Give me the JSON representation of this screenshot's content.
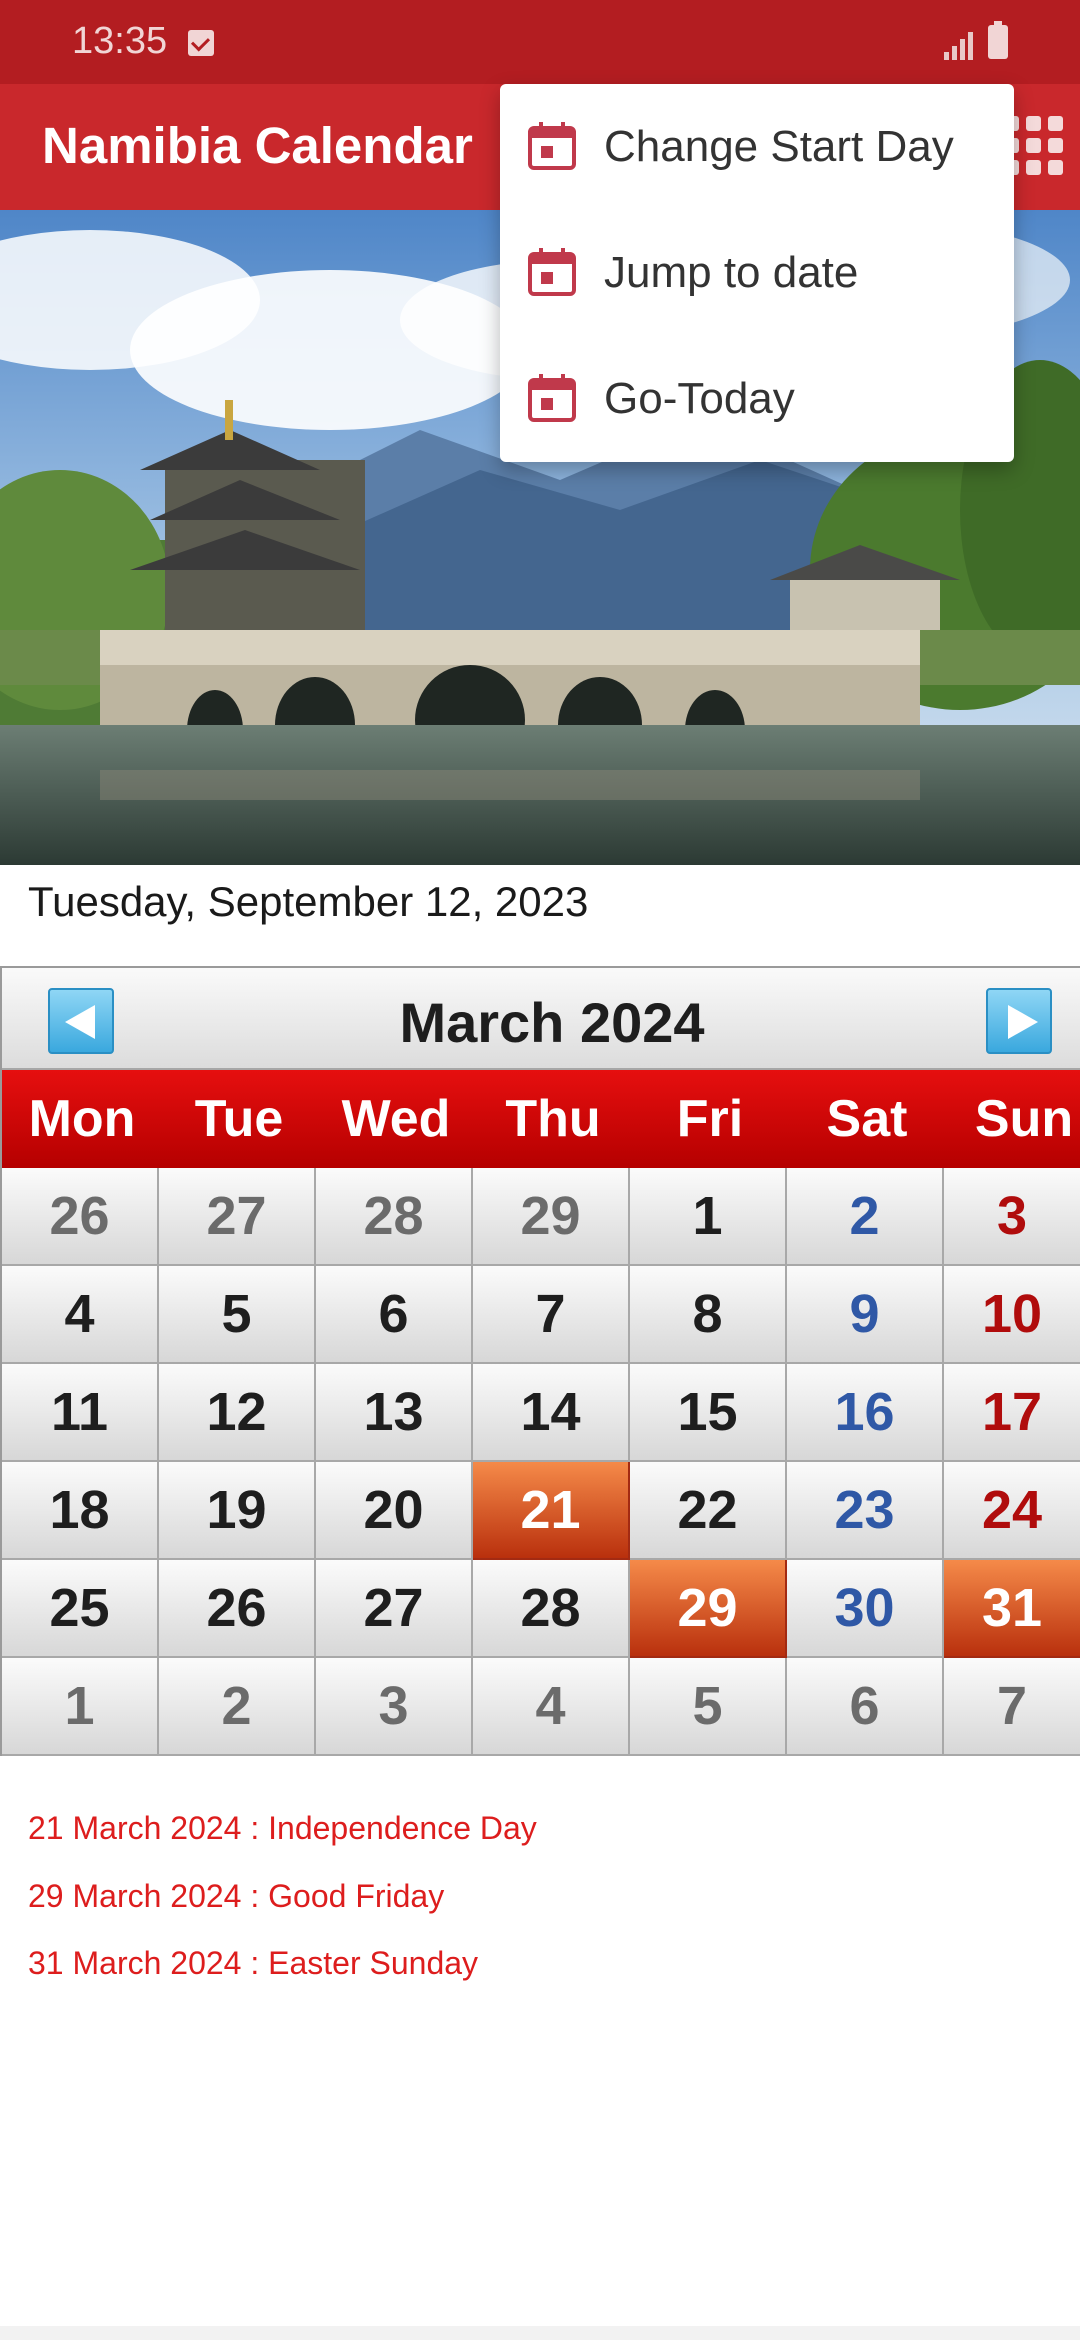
{
  "status_bar": {
    "time": "13:35"
  },
  "app_bar": {
    "title": "Namibia Calendar"
  },
  "menu": {
    "items": [
      {
        "label": "Change Start Day"
      },
      {
        "label": "Jump to date"
      },
      {
        "label": "Go-Today"
      }
    ]
  },
  "today_text": "Tuesday, September 12, 2023",
  "calendar": {
    "month_title": "March  2024",
    "weekdays": [
      "Mon",
      "Tue",
      "Wed",
      "Thu",
      "Fri",
      "Sat",
      "Sun"
    ],
    "weeks": [
      [
        "26",
        "27",
        "28",
        "29",
        "1",
        "2",
        "3"
      ],
      [
        "4",
        "5",
        "6",
        "7",
        "8",
        "9",
        "10"
      ],
      [
        "11",
        "12",
        "13",
        "14",
        "15",
        "16",
        "17"
      ],
      [
        "18",
        "19",
        "20",
        "21",
        "22",
        "23",
        "24"
      ],
      [
        "25",
        "26",
        "27",
        "28",
        "29",
        "30",
        "31"
      ],
      [
        "1",
        "2",
        "3",
        "4",
        "5",
        "6",
        "7"
      ]
    ],
    "holiday_days": [
      "21",
      "29",
      "31"
    ]
  },
  "holidays": [
    "21 March 2024 : Independence Day",
    "29 March 2024 : Good Friday",
    "31 March 2024 : Easter Sunday"
  ],
  "colors": {
    "status_bar": "#b31d21",
    "app_bar": "#c9282c",
    "weekday_header": "#d40606",
    "holiday_cell": "#d95a24",
    "saturday_text": "#2f58a6",
    "sunday_text": "#b00c0c",
    "holiday_text": "#dd1d1d"
  }
}
